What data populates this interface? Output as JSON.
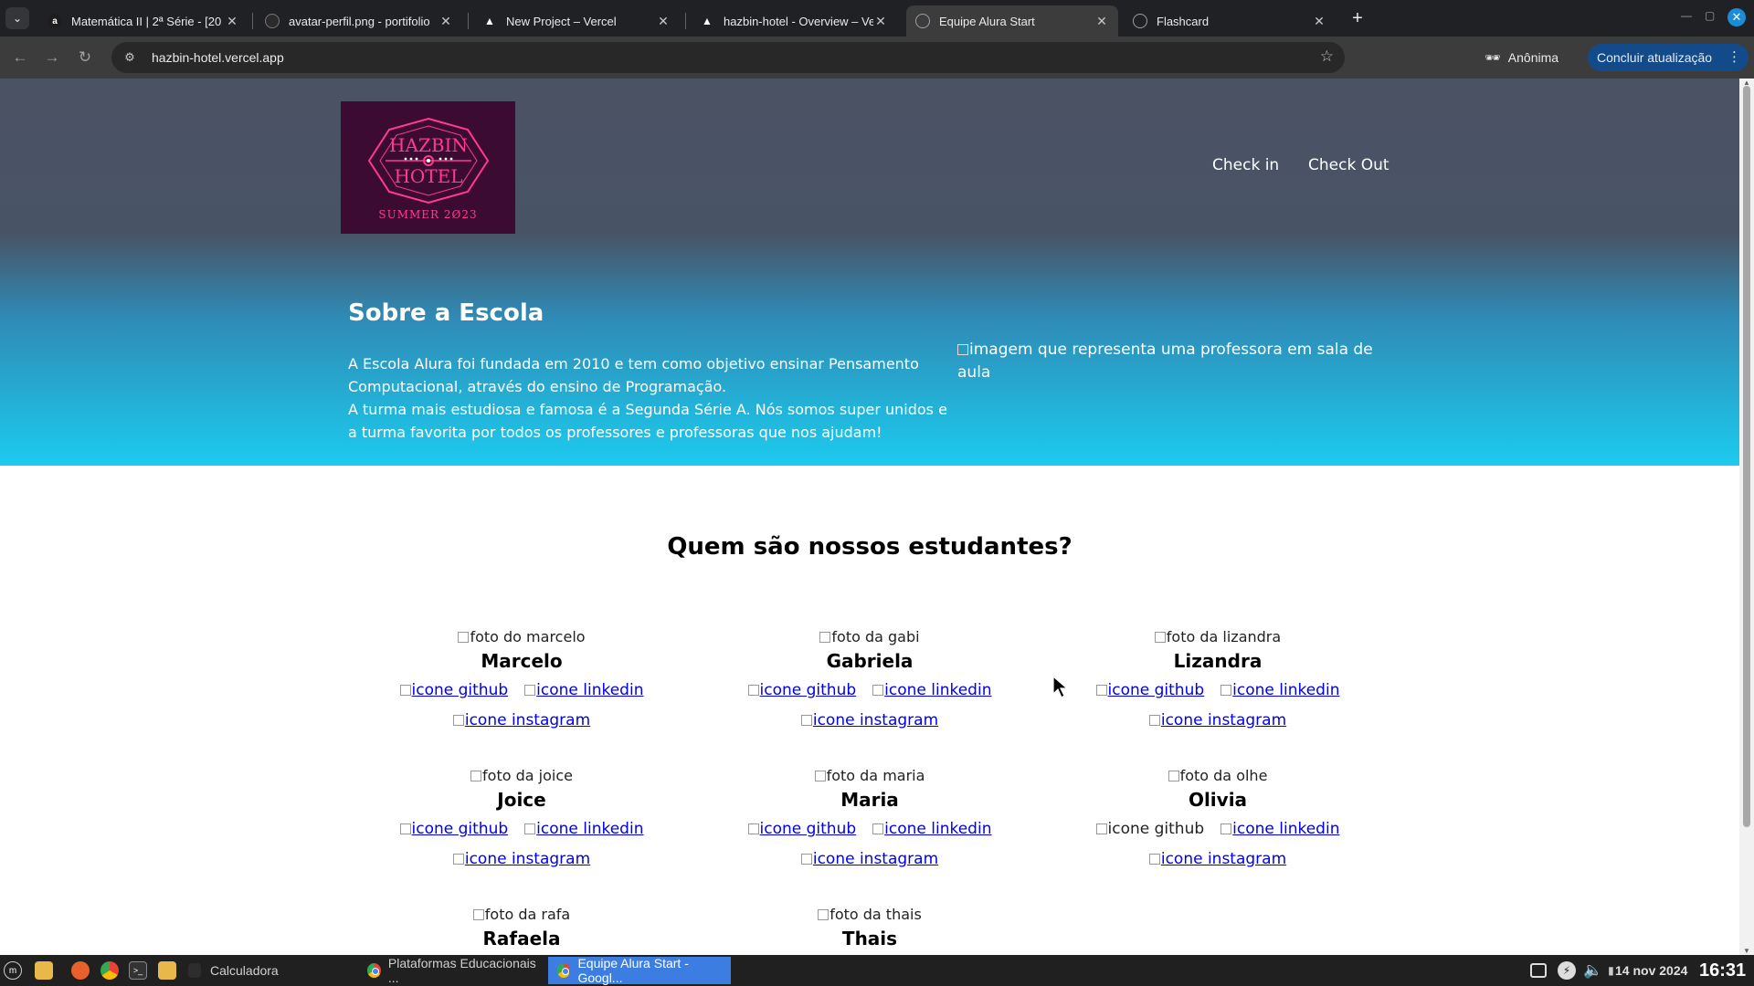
{
  "browser": {
    "tabs": [
      {
        "title": "Matemática II | 2ª Série - [20",
        "favicon": "alura-icon"
      },
      {
        "title": "avatar-perfil.png - portifolio",
        "favicon": "github-icon"
      },
      {
        "title": "New Project – Vercel",
        "favicon": "vercel-icon"
      },
      {
        "title": "hazbin-hotel - Overview – Ve",
        "favicon": "vercel-icon"
      },
      {
        "title": "Equipe Alura Start",
        "favicon": "globe-icon",
        "active": true
      },
      {
        "title": "Flashcard",
        "favicon": "globe-icon"
      }
    ],
    "url": "hazbin-hotel.vercel.app",
    "incognito_label": "Anônima",
    "update_label": "Concluir atualização"
  },
  "page": {
    "logo": {
      "line1": "HAZBIN",
      "line2": "HOTEL",
      "line3": "SUMMER 2Ø23"
    },
    "nav": {
      "check_in": "Check in",
      "check_out": "Check Out"
    },
    "about": {
      "title": "Sobre a Escola",
      "paragraph1": "A Escola Alura foi fundada em 2010 e tem como objetivo ensinar Pensamento Computacional, através do ensino de Programação.",
      "paragraph2": "A turma mais estudiosa e famosa é a Segunda Série A. Nós somos super unidos e a turma favorita por todos os professores e professoras que nos ajudam!",
      "image_alt": "imagem que representa uma professora em sala de aula"
    },
    "students_title": "Quem são nossos estudantes?",
    "students": [
      {
        "photo_alt": "foto do marcelo",
        "name": "Marcelo",
        "github": "icone github",
        "linkedin": "icone linkedin",
        "instagram": "icone instagram"
      },
      {
        "photo_alt": "foto da gabi",
        "name": "Gabriela",
        "github": "icone github",
        "linkedin": "icone linkedin",
        "instagram": "icone instagram"
      },
      {
        "photo_alt": "foto da lizandra",
        "name": "Lizandra",
        "github": "icone github",
        "linkedin": "icone linkedin",
        "instagram": "icone instagram"
      },
      {
        "photo_alt": "foto da joice",
        "name": "Joice",
        "github": "icone github",
        "linkedin": "icone linkedin",
        "instagram": "icone instagram"
      },
      {
        "photo_alt": "foto da maria",
        "name": "Maria",
        "github": "icone github",
        "linkedin": "icone linkedin",
        "instagram": "icone instagram"
      },
      {
        "photo_alt": "foto da olhe",
        "name": "Olivia",
        "github": "icone github",
        "linkedin": "icone linkedin",
        "instagram": "icone instagram"
      },
      {
        "photo_alt": "foto da rafa",
        "name": "Rafaela"
      },
      {
        "photo_alt": "foto da thais",
        "name": "Thais"
      }
    ]
  },
  "taskbar": {
    "calculator": "Calculadora",
    "window1": "Plataformas Educacionais ...",
    "window2": "Equipe Alura Start - Googl...",
    "date": "14 nov 2024",
    "time": "16:31"
  },
  "colors": {
    "hero_top": "#4b5264",
    "hero_bottom": "#1ccbee",
    "logo_bg": "#3b0b34",
    "logo_accent": "#ff3b8d",
    "link": "#0000ee"
  }
}
